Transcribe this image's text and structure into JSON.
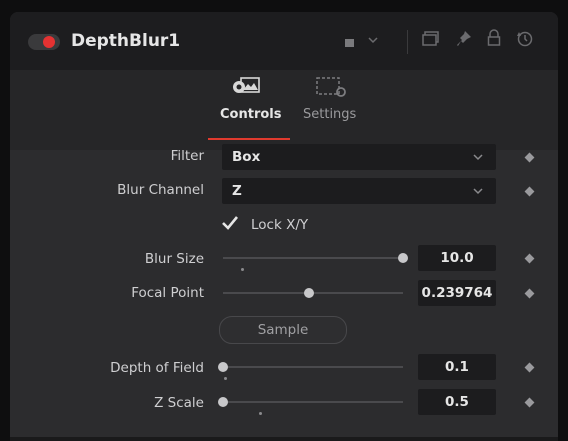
{
  "header": {
    "title": "DepthBlur1",
    "icons": [
      "toggle-switch",
      "color-swatch-menu",
      "version-icon",
      "pin-icon",
      "lock-icon",
      "reset-icon"
    ]
  },
  "tabs": [
    {
      "label": "Controls",
      "active": true,
      "icon": "controls-icon"
    },
    {
      "label": "Settings",
      "active": false,
      "icon": "settings-icon"
    }
  ],
  "controls": {
    "filter": {
      "label": "Filter",
      "value": "Box"
    },
    "blur_channel": {
      "label": "Blur Channel",
      "value": "Z"
    },
    "lock_xy": {
      "label": "Lock X/Y",
      "checked": true
    },
    "blur_size": {
      "label": "Blur Size",
      "value": "10.0",
      "level": 1.0
    },
    "focal_point": {
      "label": "Focal Point",
      "value": "0.239764",
      "level": 0.48
    },
    "sample_button": {
      "label": "Sample"
    },
    "depth_of_field": {
      "label": "Depth of Field",
      "value": "0.1",
      "level": 0.0
    },
    "z_scale": {
      "label": "Z Scale",
      "value": "0.5",
      "level": 0.0
    }
  },
  "colors": {
    "accent": "#e03a2e",
    "panel_bg": "#2b2b2d",
    "field_bg": "#1c1c1e"
  }
}
